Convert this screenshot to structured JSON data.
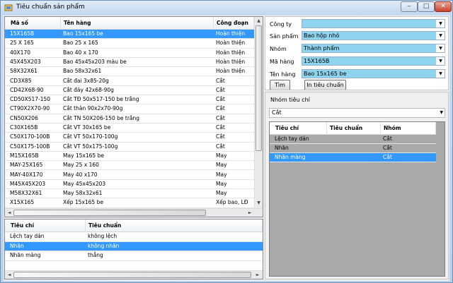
{
  "window": {
    "title": "Tiêu chuẩn sản phẩm",
    "minimize": "‒",
    "maximize": "□",
    "close": "✕"
  },
  "products": {
    "headers": [
      "Mã số",
      "Tên hàng",
      "Công đoạn"
    ],
    "rows": [
      [
        "15X165B",
        "Bao 15x165 be",
        "Hoàn thiện"
      ],
      [
        "25 X 165",
        "Bao 25 x 165",
        "Hoàn thiện"
      ],
      [
        "40X170",
        "Bao 40 x 170",
        "Hoàn thiện"
      ],
      [
        "45X45X203",
        "Bao 45x45x203 màu be",
        "Hoàn thiện"
      ],
      [
        "58X32X61",
        "Bao 58x32x61",
        "Hoàn thiện"
      ],
      [
        "CD3X85",
        "Cắt đai 3x85-20g",
        "Cắt"
      ],
      [
        "CD42X68-90",
        "Cắt đáy 42x68-90g",
        "Cắt"
      ],
      [
        "CD50X517-150",
        "Cắt TĐ 50x517-150 be trắng",
        "Cắt"
      ],
      [
        "CT90X2X70-90",
        "Cắt thân 90x2x70-90g",
        "Cắt"
      ],
      [
        "CN50X206",
        "Cắt TN 50X206-150 be trắng",
        "Cắt"
      ],
      [
        "C30X165B",
        "Cắt VT 30x165 be",
        "Cắt"
      ],
      [
        "C50X170-100B",
        "Cắt VT 50x170-100g",
        "Cắt"
      ],
      [
        "C50X175-100B",
        "Cắt VT 50x175-100g",
        "Cắt"
      ],
      [
        "M15X165B",
        "May 15x165 be",
        "May"
      ],
      [
        "MAY-25X165",
        "May 25 x 160",
        "May"
      ],
      [
        "MAY-40X170",
        "May 40 x170",
        "May"
      ],
      [
        "M45X45X203",
        "May 45x45x203",
        "May"
      ],
      [
        "M58X32X61",
        "May 58x32x61",
        "May"
      ],
      [
        "X15X165",
        "Xếp 15x165 be",
        "Xếp bao, LĐ"
      ]
    ],
    "selected": 0
  },
  "criteria": {
    "headers": [
      "Tiêu chí",
      "Tiêu chuẩn"
    ],
    "rows": [
      [
        "Lệch tay dán",
        "không lệch"
      ],
      [
        "Nhăn",
        "không nhăn"
      ],
      [
        "Nhăn màng",
        "thẳng"
      ]
    ],
    "selected": 1
  },
  "filters": [
    {
      "label": "Công ty",
      "value": ""
    },
    {
      "label": "Sản phẩm",
      "value": "Bao hộp nhỏ"
    },
    {
      "label": "Nhóm",
      "value": "Thành phẩm"
    },
    {
      "label": "Mã hàng",
      "value": "15X165B"
    },
    {
      "label": "Tên hàng",
      "value": "Bao 15x165 be"
    }
  ],
  "buttons": {
    "search": "Tìm",
    "print": "In tiêu chuẩn"
  },
  "group": {
    "title": "Nhóm tiêu chí",
    "selected_group": "Cắt",
    "headers": [
      "Tiêu chí",
      "Tiêu chuẩn",
      "Nhóm"
    ],
    "rows": [
      [
        "Lệch tay dán",
        "",
        "Cắt"
      ],
      [
        "Nhăn",
        "",
        "Cắt"
      ],
      [
        "Nhăn màng",
        "",
        "Cắt"
      ]
    ],
    "selected": 2
  },
  "icons": {
    "arrow_down": "▼",
    "arrow_up": "▲",
    "arrow_left": "◄",
    "arrow_right": "►",
    "grip": "|||"
  }
}
